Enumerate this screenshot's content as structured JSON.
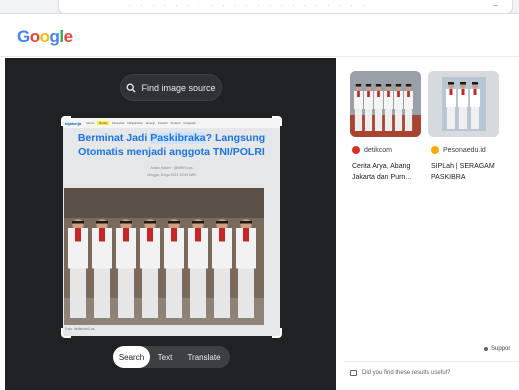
{
  "app": {
    "logo_text": "Google",
    "logo_letters": [
      "G",
      "o",
      "o",
      "g",
      "l",
      "e"
    ],
    "logo_colors": [
      "#4285F4",
      "#EA4335",
      "#FBBC05",
      "#4285F4",
      "#34A853",
      "#EA4335"
    ]
  },
  "viewer": {
    "find_source_label": "Find image source",
    "modes": {
      "search": "Search",
      "text": "Text",
      "translate": "Translate"
    },
    "selected_mode": "Search"
  },
  "document": {
    "nav_brand": "bijakerja",
    "nav_items": [
      "Home",
      "Berita",
      "Financial",
      "Infrastruktur",
      "Energi",
      "Industri",
      "Fintech",
      "Infografis"
    ],
    "nav_active_index": 1,
    "title_line1_pre": "Berminat Jadi ",
    "title_line1_hl": "Paskibraka",
    "title_line1_post": "? Langsung",
    "title_line2": "Otomatis menjadi anggota TNI/POLRI",
    "meta_author": "Ardan Hakim · @BRIFocus",
    "meta_date": "Minggu, 8 Agu 2021 10:04 WIB",
    "caption": "Foto: detikcom/Lus"
  },
  "results": [
    {
      "source": "detikcom",
      "title": "Cerita Arya, Abang Jakarta dan Purn...",
      "favicon_color": "#d93025"
    },
    {
      "source": "Pesonaedu.id",
      "title": "SIPLah | SERAGAM PASKIBRA",
      "favicon_color": "#f9ab00"
    }
  ],
  "support_label": "Suppor",
  "feedback_label": "Did you find these results useful?"
}
